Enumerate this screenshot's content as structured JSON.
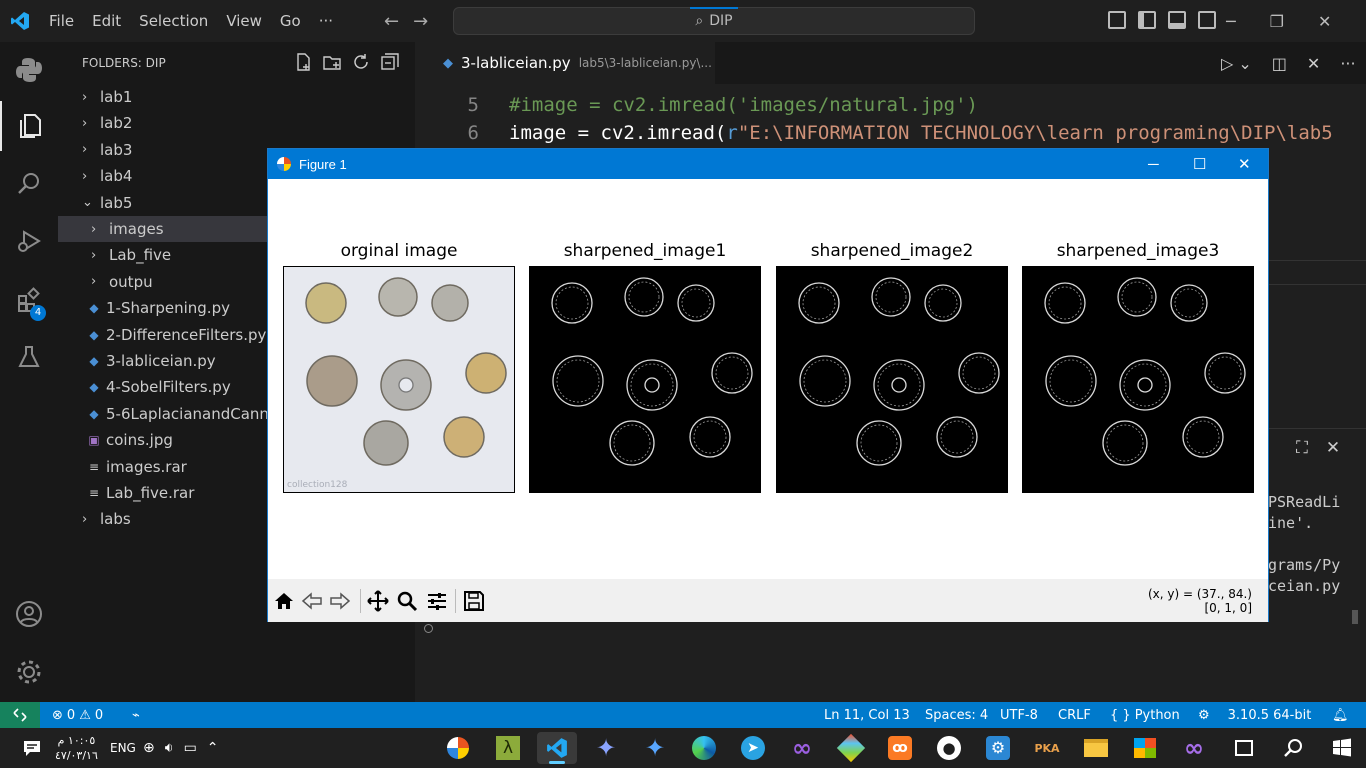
{
  "titlebar": {
    "menu": [
      "File",
      "Edit",
      "Selection",
      "View",
      "Go",
      "···"
    ],
    "search": "DIP"
  },
  "sidebar": {
    "header": "FOLDERS: DIP",
    "tree": [
      {
        "label": "lab1",
        "kind": "folder",
        "depth": 0,
        "state": "collapsed"
      },
      {
        "label": "lab2",
        "kind": "folder",
        "depth": 0,
        "state": "collapsed"
      },
      {
        "label": "lab3",
        "kind": "folder",
        "depth": 0,
        "state": "collapsed"
      },
      {
        "label": "lab4",
        "kind": "folder",
        "depth": 0,
        "state": "collapsed"
      },
      {
        "label": "lab5",
        "kind": "folder",
        "depth": 0,
        "state": "expanded"
      },
      {
        "label": "images",
        "kind": "folder",
        "depth": 1,
        "state": "collapsed",
        "selected": true
      },
      {
        "label": "Lab_five",
        "kind": "folder",
        "depth": 1,
        "state": "collapsed"
      },
      {
        "label": "outpu",
        "kind": "folder",
        "depth": 1,
        "state": "collapsed"
      },
      {
        "label": "1-Sharpening.py",
        "kind": "python",
        "depth": 1
      },
      {
        "label": "2-DifferenceFilters.py",
        "kind": "python",
        "depth": 1
      },
      {
        "label": "3-labliceian.py",
        "kind": "python",
        "depth": 1
      },
      {
        "label": "4-SobelFilters.py",
        "kind": "python",
        "depth": 1
      },
      {
        "label": "5-6LaplacianandCannyEdgeDetection.py",
        "kind": "python",
        "depth": 1
      },
      {
        "label": "coins.jpg",
        "kind": "image",
        "depth": 1
      },
      {
        "label": "images.rar",
        "kind": "archive",
        "depth": 1
      },
      {
        "label": "Lab_five.rar",
        "kind": "archive",
        "depth": 1
      },
      {
        "label": "labs",
        "kind": "folder",
        "depth": 0,
        "state": "collapsed"
      }
    ]
  },
  "activity": {
    "extensions_badge": "4"
  },
  "editor": {
    "tab_name": "3-labliceian.py",
    "tab_path": "lab5\\3-labliceian.py\\...",
    "lines": [
      {
        "number": "5",
        "comment": "#image = cv2.imread('images/natural.jpg')"
      },
      {
        "number": "6",
        "var": "image",
        "eq": " = ",
        "fn": "cv2.imread(",
        "prefix": "r",
        "str": "\"E:\\INFORMATION TECHNOLOGY\\learn programing\\DIP\\lab5"
      }
    ]
  },
  "terminal": {
    "lines": [
      "PSReadLi",
      "ine'.",
      "",
      "grams/Py",
      "ceian.py"
    ]
  },
  "figure": {
    "title": "Figure 1",
    "subplots": [
      {
        "title": "orginal image",
        "kind": "orig",
        "watermark": "collection128"
      },
      {
        "title": "sharpened_image1",
        "kind": "sharp"
      },
      {
        "title": "sharpened_image2",
        "kind": "sharp"
      },
      {
        "title": "sharpened_image3",
        "kind": "sharp"
      }
    ],
    "coord_line1": "(x, y) = (37., 84.)",
    "coord_line2": "[0, 1, 0]"
  },
  "statusbar": {
    "errors": "0",
    "warnings": "0",
    "position": "Ln 11, Col 13",
    "spaces": "Spaces: 4",
    "encoding": "UTF-8",
    "eol": "CRLF",
    "language": "Python",
    "interpreter": "3.10.5 64-bit"
  },
  "taskbar": {
    "time": "١٠:٠٥ م",
    "date": "٤٧/٠٣/١٦",
    "language": "ENG"
  },
  "colors": {
    "accent": "#0078d4",
    "statusbar": "#007acc",
    "remote": "#16825d"
  }
}
